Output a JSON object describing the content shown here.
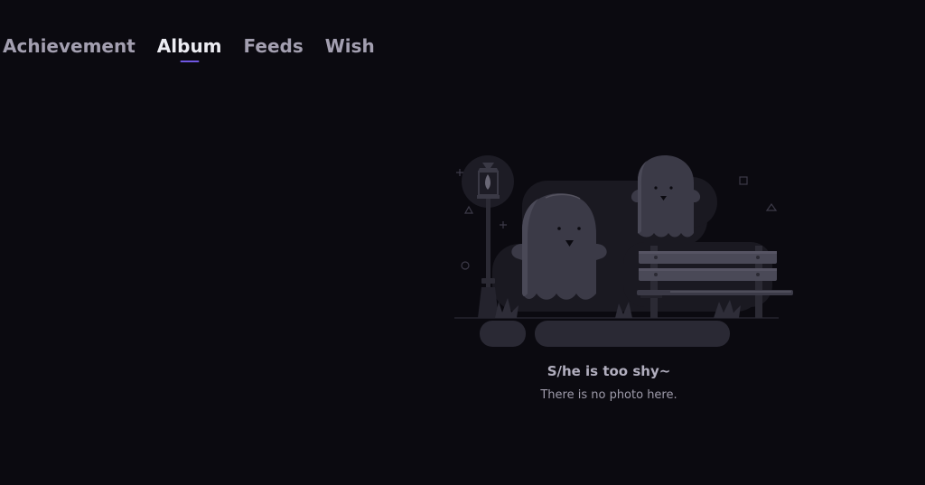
{
  "tabs": [
    {
      "label": "Achievement",
      "active": false
    },
    {
      "label": "Album",
      "active": true
    },
    {
      "label": "Feeds",
      "active": false
    },
    {
      "label": "Wish",
      "active": false
    }
  ],
  "empty_state": {
    "illustration": "ghosts-on-park-bench-illustration",
    "title": "S/he is too shy~",
    "subtitle": "There is no photo here."
  },
  "colors": {
    "background": "#0b0a10",
    "tab_active": "#ececf2",
    "tab_inactive": "#a39fb0",
    "accent": "#7057e3"
  }
}
